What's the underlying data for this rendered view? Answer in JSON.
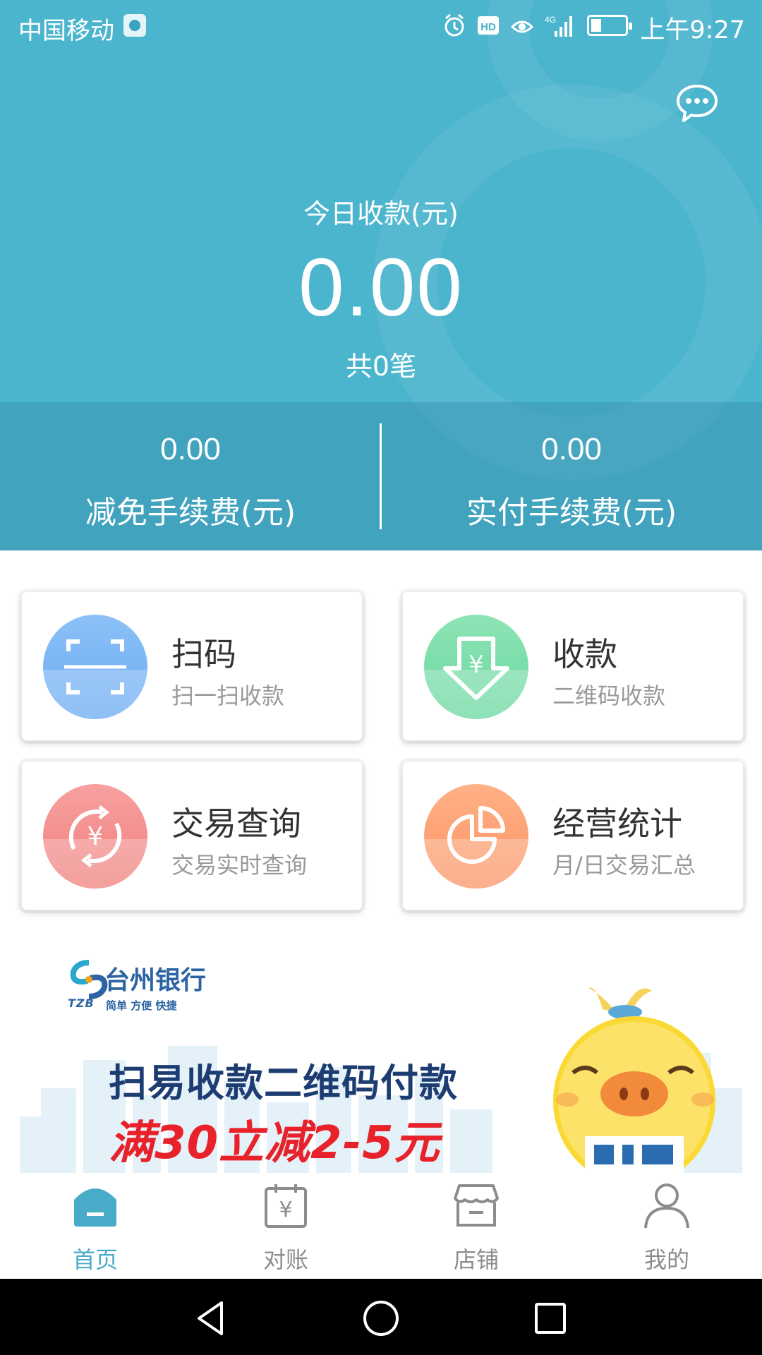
{
  "status_bar": {
    "carrier": "中国移动",
    "time": "上午9:27",
    "icons": [
      "alarm-icon",
      "hd-icon",
      "eye-icon",
      "signal-4g-icon",
      "battery-icon"
    ]
  },
  "header": {
    "today_label": "今日收款(元)",
    "today_amount": "0.00",
    "count": "共0笔",
    "fees": [
      {
        "value": "0.00",
        "label": "减免手续费(元)"
      },
      {
        "value": "0.00",
        "label": "实付手续费(元)"
      }
    ],
    "background_color": "#4cb5ce"
  },
  "cards": [
    {
      "title": "扫码",
      "subtitle": "扫一扫收款",
      "icon": "scan-icon",
      "color": "#7bb5f5"
    },
    {
      "title": "收款",
      "subtitle": "二维码收款",
      "icon": "receive-money-icon",
      "color": "#73dca5"
    },
    {
      "title": "交易查询",
      "subtitle": "交易实时查询",
      "icon": "transaction-query-icon",
      "color": "#f28d8b"
    },
    {
      "title": "经营统计",
      "subtitle": "月/日交易汇总",
      "icon": "pie-chart-icon",
      "color": "#fca072"
    }
  ],
  "banner": {
    "bank_name": "台州银行",
    "bank_en": "TZB",
    "slogan": "简单 方便 快捷",
    "promo_line1": "扫易收款二维码付款",
    "promo_line2": "满30立减2-5元"
  },
  "tabs": [
    {
      "label": "首页",
      "icon": "home-icon",
      "active": true
    },
    {
      "label": "对账",
      "icon": "calendar-yuan-icon",
      "active": false
    },
    {
      "label": "店铺",
      "icon": "shop-icon",
      "active": false
    },
    {
      "label": "我的",
      "icon": "user-icon",
      "active": false
    }
  ],
  "colors": {
    "accent": "#48acc8",
    "inactive": "#8c8c8c"
  }
}
